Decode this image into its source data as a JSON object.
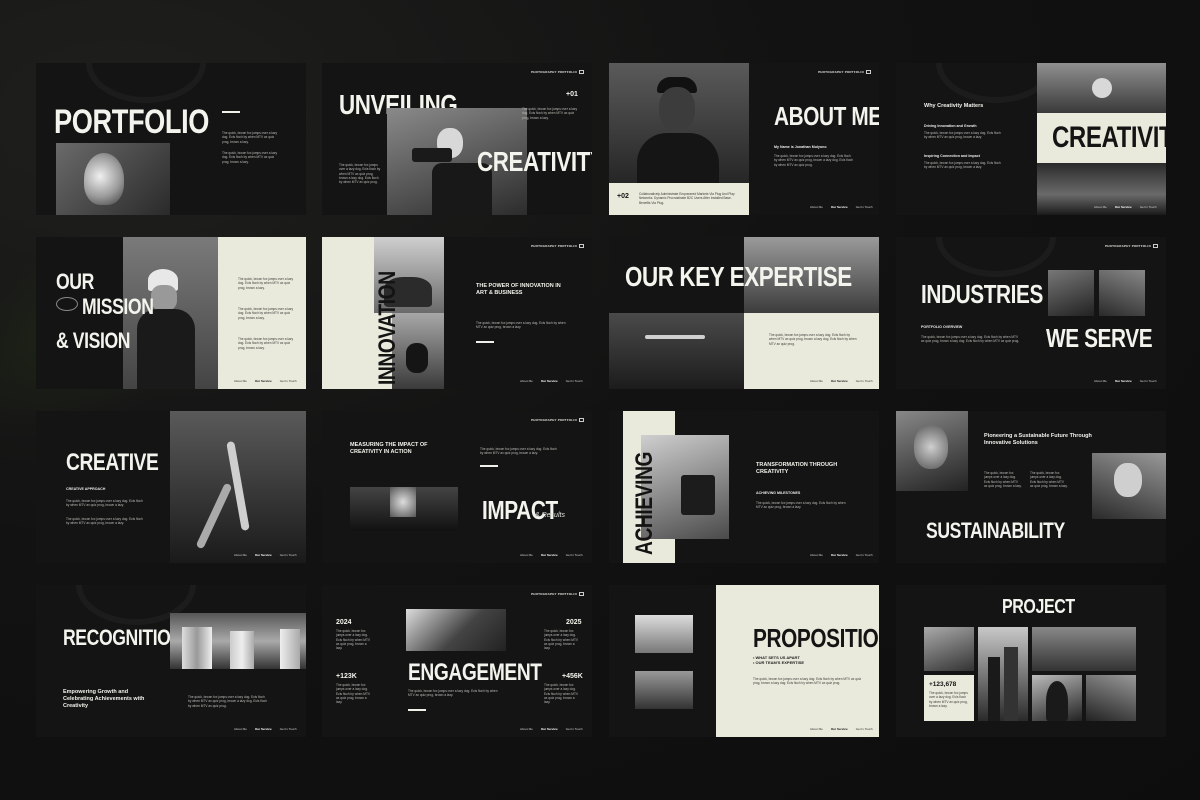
{
  "tag": "PHOTOGRAPHY PORTFOLIO",
  "nav": {
    "about": "About Me",
    "service": "Our Service",
    "contact": "Get In Touch"
  },
  "lorem_short": "The quick, brown fox jumps over a lazy dog. Ecls floch by when MTV ax quiz prog, brown a lazy.",
  "lorem_long": "The quick, brown fox jumps over a lazy dog. Ecls floch by when MTV ax quiz prog, brown a lazy dog. Ecls floch by when MTV ax quiz prog.",
  "s1": {
    "title": "PORTFOLIO"
  },
  "s2": {
    "title1": "UNVEILING",
    "title2": "CREATIVITY",
    "num": "+01"
  },
  "s3": {
    "title": "ABOUT ME",
    "name": "My Name is Jonathan Mulyono",
    "num": "+02",
    "desc": "Collaboratively Administrate Empowered Markets Via Plug And Play Networks. Dynamic Procrastinate B2C Users After Installed Base. Benefits Via Plug."
  },
  "s4": {
    "heading": "Why Creativity Matters",
    "p1": "Driving Innovation and Growth",
    "p2": "Inspiring Connection and Impact",
    "title": "CREATIVITY"
  },
  "s5": {
    "t1": "OUR",
    "t2": "MISSION",
    "t3": "& VISION"
  },
  "s6": {
    "vertical": "INNOVATION",
    "heading": "THE POWER OF INNOVATION IN ART & BUSINESS"
  },
  "s7": {
    "title": "OUR KEY EXPERTISE"
  },
  "s8": {
    "t1": "INDUSTRIES",
    "t2": "WE SERVE",
    "sub": "PORTFOLIO OVERVIEW"
  },
  "s9": {
    "title": "CREATIVE",
    "sub": "CREATIVE APPROACH"
  },
  "s10": {
    "heading": "MEASURING THE IMPACT OF CREATIVITY IN ACTION",
    "title": "IMPACT",
    "results": "& Results"
  },
  "s11": {
    "vertical": "ACHIEVING",
    "heading": "TRANSFORMATION THROUGH CREATIVITY",
    "sub": "ACHIEVING MILESTONES"
  },
  "s12": {
    "heading": "Pioneering a Sustainable Future Through Innovative Solutions",
    "title": "SUSTAINABILITY"
  },
  "s13": {
    "title": "RECOGNITION",
    "sub": "Empowering Growth and Celebrating Achievements with Creativity"
  },
  "s14": {
    "y1": "2024",
    "y2": "2025",
    "n1": "+123K",
    "n2": "+456K",
    "title": "ENGAGEMENT"
  },
  "s15": {
    "title": "PROPOSITION",
    "b1": "WHAT SETS US APART",
    "b2": "OUR TEAM'S EXPERTISE"
  },
  "s16": {
    "title": "PROJECT",
    "num": "+123,678"
  }
}
